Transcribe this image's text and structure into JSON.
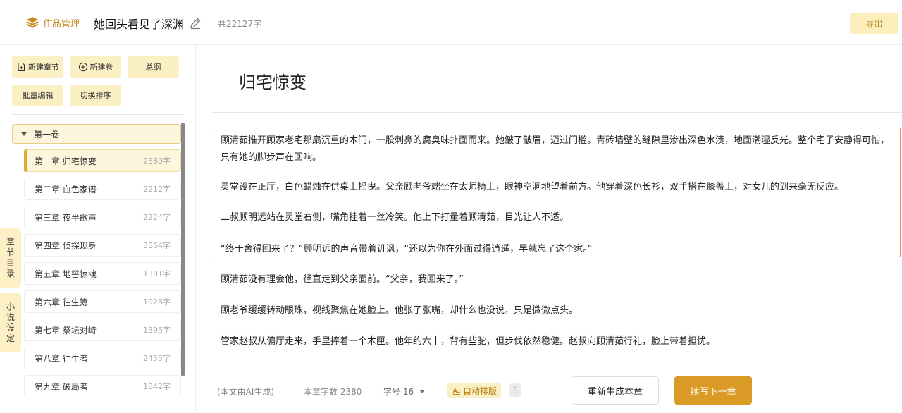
{
  "header": {
    "brand_label": "作品管理",
    "book_title": "她回头看见了深渊",
    "word_total": "共22127字",
    "export_label": "导出"
  },
  "sidebar": {
    "tools": {
      "new_chapter": "新建章节",
      "new_volume": "新建卷",
      "outline": "总纲",
      "batch_edit": "批量编辑",
      "toggle_sort": "切换排序"
    },
    "volume": "第一卷",
    "chapters": [
      {
        "label": "第一章 归宅惊变",
        "count": "2380字"
      },
      {
        "label": "第二章 血色家谱",
        "count": "2212字"
      },
      {
        "label": "第三章 夜半歌声",
        "count": "2224字"
      },
      {
        "label": "第四章 侦探现身",
        "count": "3864字"
      },
      {
        "label": "第五章 地窖惊魂",
        "count": "1381字"
      },
      {
        "label": "第六章 往生簿",
        "count": "1928字"
      },
      {
        "label": "第七章 祭坛对峙",
        "count": "1395字"
      },
      {
        "label": "第八章 往生者",
        "count": "2455字"
      },
      {
        "label": "第九章 破局者",
        "count": "1842字"
      }
    ],
    "side_tabs": {
      "chapter_toc": [
        "章",
        "节",
        "目",
        "录"
      ],
      "novel_settings": [
        "小",
        "说",
        "设",
        "定"
      ]
    }
  },
  "editor": {
    "chapter_title": "归宅惊变",
    "paragraphs": [
      "顾清茹推开顾家老宅那扇沉重的木门，一股刺鼻的腐臭味扑面而来。她皱了皱眉，迈过门槛。青砖墙壁的缝隙里渗出深色水渍，地面潮湿反光。整个宅子安静得可怕，只有她的脚步声在回响。",
      "灵堂设在正厅，白色蜡烛在供桌上摇曳。父亲顾老爷端坐在太师椅上，眼神空洞地望着前方。他穿着深色长衫，双手搭在膝盖上，对女儿的到来毫无反应。",
      "二叔顾明远站在灵堂右侧，嘴角挂着一丝冷笑。他上下打量着顾清茹，目光让人不适。",
      "“终于舍得回来了？”顾明远的声音带着讥讽，“还以为你在外面过得逍遥，早就忘了这个家。”",
      "顾清茹没有理会他，径直走到父亲面前。“父亲，我回来了。”",
      "顾老爷缓缓转动眼珠，视线聚焦在她脸上。他张了张嘴，却什么也没说，只是微微点头。",
      "管家赵叔从偏厅走来，手里捧着一个木匣。他年约六十，背有些驼，但步伐依然稳健。赵叔向顾清茹行礼，脸上带着担忧。"
    ]
  },
  "footer": {
    "ai_note": "(本文由AI生成)",
    "chapter_word_count": "本章字数 2380",
    "font_size": "字号 16",
    "auto_layout": "自动排版",
    "more": "⋮",
    "regenerate": "重新生成本章",
    "continue": "续写下一章"
  },
  "colors": {
    "accent": "#d99a26",
    "accent_light": "#fbefc4",
    "selection_border": "#f08a8a"
  }
}
